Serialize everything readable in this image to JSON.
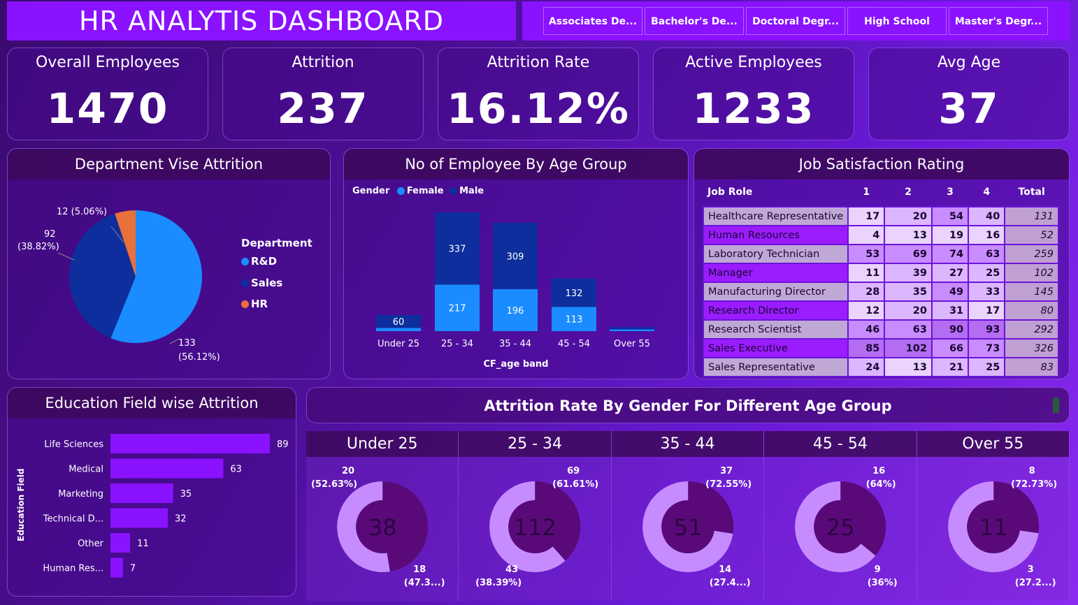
{
  "header": {
    "title": "HR ANALYTIS DASHBOARD"
  },
  "education_slicer": [
    "Associates De...",
    "Bachelor's De...",
    "Doctoral Degr...",
    "High School",
    "Master's Degr..."
  ],
  "kpis": [
    {
      "label": "Overall Employees",
      "value": "1470"
    },
    {
      "label": "Attrition",
      "value": "237"
    },
    {
      "label": "Attrition Rate",
      "value": "16.12%"
    },
    {
      "label": "Active Employees",
      "value": "1233"
    },
    {
      "label": "Avg Age",
      "value": "37"
    }
  ],
  "dept_attrition": {
    "title": "Department Vise Attrition",
    "legend_title": "Department",
    "slices": [
      {
        "name": "R&D",
        "value": 133,
        "label": "133",
        "pct": "(56.12%)",
        "color": "#1a8cff"
      },
      {
        "name": "Sales",
        "value": 92,
        "label": "92",
        "pct": "(38.82%)",
        "color": "#0d2e9c"
      },
      {
        "name": "HR",
        "value": 12,
        "label": "12 (5.06%)",
        "pct": "",
        "color": "#e8703a"
      }
    ]
  },
  "age_group": {
    "title": "No of Employee By Age Group",
    "legend_title": "Gender",
    "legend": [
      {
        "name": "Female",
        "color": "#1a8cff"
      },
      {
        "name": "Male",
        "color": "#0d2e9c"
      }
    ],
    "xlabel": "CF_age band",
    "categories": [
      "Under 25",
      "25 - 34",
      "35 - 44",
      "45 - 54",
      "Over 55"
    ],
    "female": [
      15,
      217,
      196,
      113,
      8
    ],
    "male": [
      60,
      337,
      309,
      132,
      11
    ],
    "male_labels": [
      "60",
      "337",
      "309",
      "132",
      ""
    ],
    "female_labels": [
      "",
      "217",
      "196",
      "113",
      ""
    ]
  },
  "job_satisfaction": {
    "title": "Job Satisfaction Rating",
    "columns": [
      "Job Role",
      "1",
      "2",
      "3",
      "4",
      "Total"
    ],
    "rows": [
      [
        "Healthcare Representative",
        "17",
        "20",
        "54",
        "40",
        "131"
      ],
      [
        "Human Resources",
        "4",
        "13",
        "19",
        "16",
        "52"
      ],
      [
        "Laboratory Technician",
        "53",
        "69",
        "74",
        "63",
        "259"
      ],
      [
        "Manager",
        "11",
        "39",
        "27",
        "25",
        "102"
      ],
      [
        "Manufacturing Director",
        "28",
        "35",
        "49",
        "33",
        "145"
      ],
      [
        "Research Director",
        "12",
        "20",
        "31",
        "17",
        "80"
      ],
      [
        "Research Scientist",
        "46",
        "63",
        "90",
        "93",
        "292"
      ],
      [
        "Sales Executive",
        "85",
        "102",
        "66",
        "73",
        "326"
      ],
      [
        "Sales Representative",
        "24",
        "13",
        "21",
        "25",
        "83"
      ]
    ]
  },
  "education_attrition": {
    "title": "Education Field wise Attrition",
    "ylabel": "Education Field",
    "categories": [
      "Life Sciences",
      "Medical",
      "Marketing",
      "Technical D...",
      "Other",
      "Human Res..."
    ],
    "values": [
      89,
      63,
      35,
      32,
      11,
      7
    ]
  },
  "gender_attrition": {
    "title": "Attrition Rate By Gender For Different Age Group",
    "groups": [
      {
        "name": "Under 25",
        "total": "38",
        "a": 20,
        "a_label": "20",
        "a_pct": "(52.63%)",
        "b": 18,
        "b_label": "18",
        "b_pct": "(47.3...)"
      },
      {
        "name": "25 - 34",
        "total": "112",
        "a": 69,
        "a_label": "69",
        "a_pct": "(61.61%)",
        "b": 43,
        "b_label": "43",
        "b_pct": "(38.39%)"
      },
      {
        "name": "35 - 44",
        "total": "51",
        "a": 37,
        "a_label": "37",
        "a_pct": "(72.55%)",
        "b": 14,
        "b_label": "14",
        "b_pct": "(27.4...)"
      },
      {
        "name": "45 - 54",
        "total": "25",
        "a": 16,
        "a_label": "16",
        "a_pct": "(64%)",
        "b": 9,
        "b_label": "9",
        "b_pct": "(36%)"
      },
      {
        "name": "Over 55",
        "total": "11",
        "a": 8,
        "a_label": "8",
        "a_pct": "(72.73%)",
        "b": 3,
        "b_label": "3",
        "b_pct": "(27.2...)"
      }
    ]
  },
  "chart_data": [
    {
      "type": "pie",
      "title": "Department Vise Attrition",
      "categories": [
        "R&D",
        "Sales",
        "HR"
      ],
      "values": [
        133,
        92,
        12
      ]
    },
    {
      "type": "bar",
      "title": "No of Employee By Age Group",
      "xlabel": "CF_age band",
      "categories": [
        "Under 25",
        "25 - 34",
        "35 - 44",
        "45 - 54",
        "Over 55"
      ],
      "series": [
        {
          "name": "Female",
          "values": [
            15,
            217,
            196,
            113,
            8
          ]
        },
        {
          "name": "Male",
          "values": [
            60,
            337,
            309,
            132,
            11
          ]
        }
      ]
    },
    {
      "type": "bar",
      "title": "Education Field wise Attrition",
      "ylabel": "Education Field",
      "categories": [
        "Life Sciences",
        "Medical",
        "Marketing",
        "Technical D...",
        "Other",
        "Human Res..."
      ],
      "values": [
        89,
        63,
        35,
        32,
        11,
        7
      ]
    },
    {
      "type": "pie",
      "title": "Attrition Rate By Gender For Different Age Group",
      "categories": [
        "Under 25",
        "25 - 34",
        "35 - 44",
        "45 - 54",
        "Over 55"
      ],
      "series": [
        {
          "values": [
            20,
            69,
            37,
            16,
            8
          ]
        },
        {
          "values": [
            18,
            43,
            14,
            9,
            3
          ]
        }
      ]
    }
  ]
}
